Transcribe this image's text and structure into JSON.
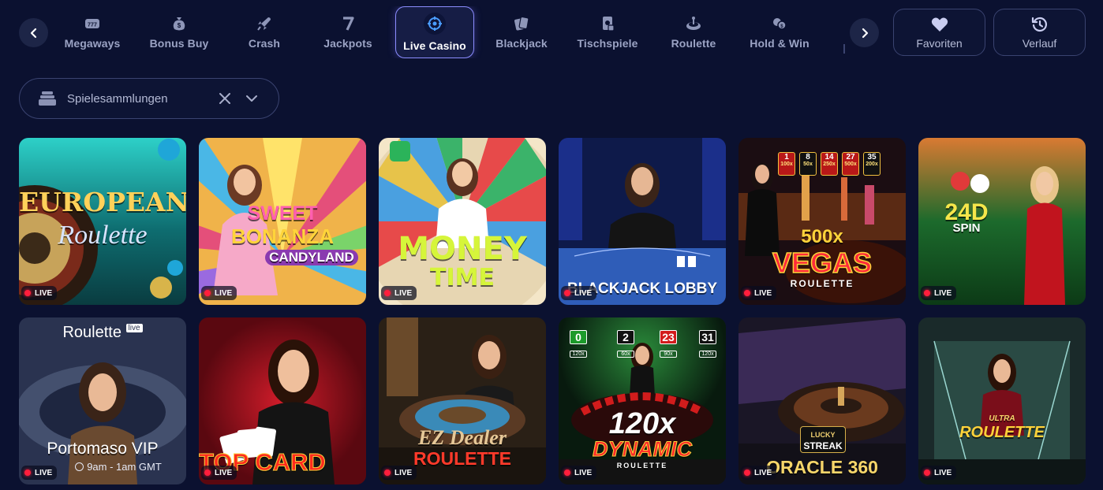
{
  "categories": [
    {
      "label": "Megaways",
      "icon": "megaways-icon",
      "active": false
    },
    {
      "label": "Bonus Buy",
      "icon": "money-bag-icon",
      "active": false
    },
    {
      "label": "Crash",
      "icon": "rocket-icon",
      "active": false
    },
    {
      "label": "Jackpots",
      "icon": "seven-icon",
      "active": false
    },
    {
      "label": "Live Casino",
      "icon": "live-casino-icon",
      "active": true
    },
    {
      "label": "Blackjack",
      "icon": "cards-icon",
      "active": false
    },
    {
      "label": "Tischspiele",
      "icon": "table-games-icon",
      "active": false
    },
    {
      "label": "Roulette",
      "icon": "roulette-icon",
      "active": false
    },
    {
      "label": "Hold & Win",
      "icon": "hold-win-icon",
      "active": false
    }
  ],
  "header": {
    "favorites_label": "Favoriten",
    "history_label": "Verlauf"
  },
  "collections": {
    "placeholder": "Spielesammlungen"
  },
  "live_label": "LIVE",
  "games": [
    {
      "title_line1": "EUROPEAN",
      "title_line2": "Roulette"
    },
    {
      "title_line1": "SWEET",
      "title_line2": "BONANZA",
      "title_line3": "CANDYLAND"
    },
    {
      "title_line1": "MONEY",
      "title_line2": "TIME"
    },
    {
      "title_line1": "BLACKJACK LOBBY"
    },
    {
      "multiplier": "500x",
      "title_line1": "VEGAS",
      "title_line2": "ROULETTE",
      "boxes": [
        "1",
        "8",
        "14",
        "27",
        "35"
      ],
      "box_mults": [
        "100x",
        "50x",
        "250x",
        "500x",
        "200x"
      ]
    },
    {
      "title_line1": "24D",
      "title_line2": "SPIN"
    },
    {
      "title_top": "Roulette",
      "title_top_badge": "live",
      "title_line1": "Portomaso VIP",
      "schedule": "9am - 1am GMT"
    },
    {
      "title_line1": "TOP CARD"
    },
    {
      "title_line1": "EZ Dealer",
      "title_line2": "ROULETTE"
    },
    {
      "multiplier": "120x",
      "title_line1": "DYNAMIC",
      "title_line2": "ROULETTE",
      "boxes": [
        "0",
        "2",
        "23",
        "31"
      ],
      "box_mults": [
        "120x",
        "60x",
        "90x",
        "120x"
      ]
    },
    {
      "badge_line1": "LUCKY",
      "badge_line2": "STREAK",
      "title_line1": "ORACLE 360"
    },
    {
      "badge": "ULTRA",
      "title_line1": "ROULETTE"
    }
  ],
  "colors": {
    "background": "#0b1130",
    "accent": "#8c8dff",
    "live_dot": "#ff1e3c"
  }
}
